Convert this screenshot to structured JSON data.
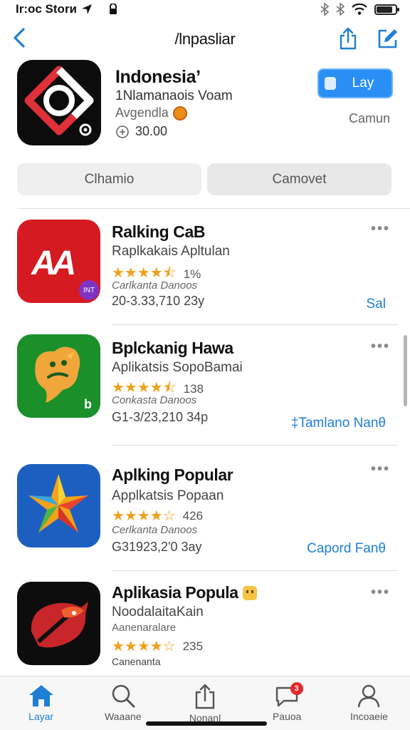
{
  "status_bar": {
    "carrier": "Ir:oc Storи"
  },
  "nav": {
    "title": "/lnpasliar"
  },
  "featured": {
    "title": "Indonesiaʼ",
    "subtitle": "1Nlamanaois Voam",
    "category": "Avgendla",
    "rating": "30.00",
    "get_label": "Lay",
    "side_label": "Camun"
  },
  "segments": {
    "left": "Clhamio",
    "right": "Camovet"
  },
  "apps": [
    {
      "title": "Ralking CaB",
      "subtitle": "Raplkakais Apltulan",
      "rating_count": "1%",
      "category": "Carlkanta Danoos",
      "meta": "20-3.33,710 23y",
      "action": "Sal",
      "icon_text": "AA",
      "badge_text": "INT"
    },
    {
      "title": "Bplckanig Hawa",
      "subtitle": "Aplikatsis SopoBamai",
      "rating_count": "138",
      "category": "Conkasta Danoos",
      "meta": "G1-3/23,210 34p",
      "action": "‡Tamlano Nanθ",
      "icon_text": "b"
    },
    {
      "title": "Aplking Popular",
      "subtitle": "Applkatsis Popaan",
      "rating_count": "426",
      "category": "Cerlkanta Danoos",
      "meta": "G31923,2'0 3ay",
      "action": "Capord Fanθ"
    },
    {
      "title": "Aplikasia Popula",
      "subtitle": "NoodalaitaKain",
      "rating_count": "235",
      "category": "Aanenaralare",
      "meta": "Canenanta"
    }
  ],
  "tabs": [
    {
      "label": "Layar",
      "icon": "home-icon"
    },
    {
      "label": "Waaane",
      "icon": "search-icon"
    },
    {
      "label": "Nonanl",
      "icon": "share-icon"
    },
    {
      "label": "Pauoa",
      "icon": "chat-icon",
      "badge": "3"
    },
    {
      "label": "Incoaeie",
      "icon": "person-icon"
    }
  ],
  "colors": {
    "accent": "#1e7fd4",
    "get_button": "#2a8ff5",
    "star": "#f0a01a",
    "badge": "#e5282a"
  },
  "star_ratings": [
    4.5,
    4.5,
    4.0,
    4.0
  ]
}
